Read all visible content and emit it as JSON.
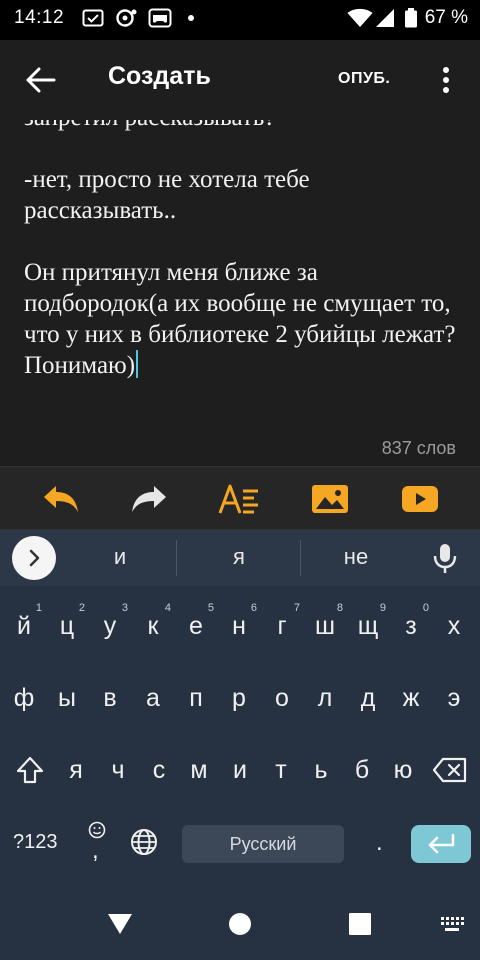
{
  "status_bar": {
    "time": "14:12",
    "battery_percent": "67 %",
    "icons": [
      "checkbox-notification-icon",
      "bubble-notification-icon",
      "gamepad-icon",
      "dot-icon",
      "wifi-icon",
      "signal-icon",
      "battery-icon"
    ]
  },
  "app_bar": {
    "title": "Создать",
    "publish_label": "ОПУБ.",
    "icons": [
      "back-arrow-icon",
      "more-vert-icon"
    ]
  },
  "editor": {
    "paragraphs": [
      "запретил рассказывать?",
      "-нет, просто не хотела тебе рассказывать..",
      "Он притянул меня ближе за подбородок(а их вообще не смущает то, что у них в библиотеке 2 убийцы лежат? Понимаю)"
    ],
    "word_count": "837 слов"
  },
  "toolbar": {
    "icons": [
      "undo-icon",
      "redo-icon",
      "text-format-icon",
      "insert-image-icon",
      "insert-video-icon"
    ],
    "accent_color": "#f5a623"
  },
  "keyboard": {
    "suggestions": [
      "и",
      "я",
      "не"
    ],
    "row1": [
      {
        "label": "й",
        "hint": "1"
      },
      {
        "label": "ц",
        "hint": "2"
      },
      {
        "label": "у",
        "hint": "3"
      },
      {
        "label": "к",
        "hint": "4"
      },
      {
        "label": "е",
        "hint": "5"
      },
      {
        "label": "н",
        "hint": "6"
      },
      {
        "label": "г",
        "hint": "7"
      },
      {
        "label": "ш",
        "hint": "8"
      },
      {
        "label": "щ",
        "hint": "9"
      },
      {
        "label": "з",
        "hint": "0"
      },
      {
        "label": "х",
        "hint": ""
      }
    ],
    "row2": [
      "ф",
      "ы",
      "в",
      "а",
      "п",
      "р",
      "о",
      "л",
      "д",
      "ж",
      "э"
    ],
    "row3": [
      "я",
      "ч",
      "с",
      "м",
      "и",
      "т",
      "ь",
      "б",
      "ю"
    ],
    "symbols_label": "?123",
    "comma_label": ",",
    "period_label": ".",
    "space_label": "Русский",
    "enter_color": "#7ec8d6"
  },
  "nav_bar": {
    "icons": [
      "back-triangle-icon",
      "home-circle-icon",
      "recents-square-icon",
      "keyboard-switch-icon"
    ]
  }
}
